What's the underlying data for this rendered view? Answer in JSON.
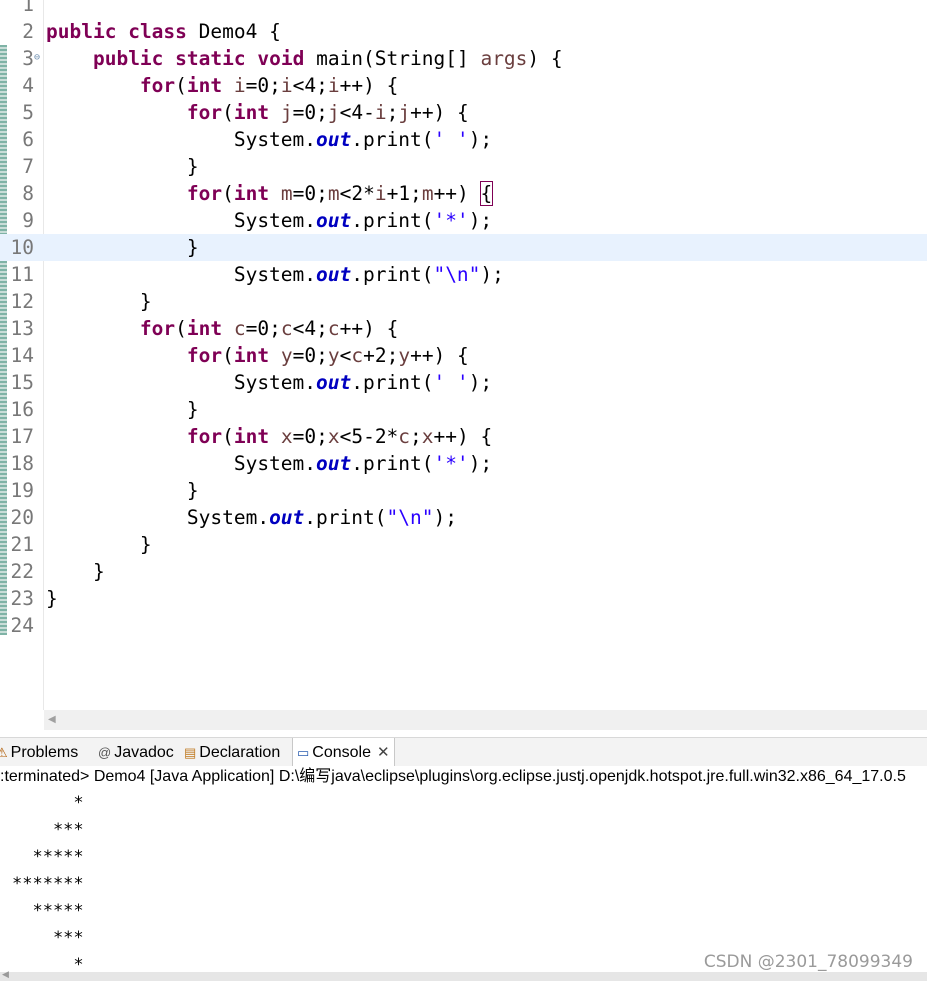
{
  "editor": {
    "lines": [
      {
        "n": "1",
        "code": ""
      },
      {
        "n": "2",
        "code": "public class Demo4 {"
      },
      {
        "n": "3",
        "code": "    public static void main(String[] args) {"
      },
      {
        "n": "4",
        "code": "        for(int i=0;i<4;i++) {"
      },
      {
        "n": "5",
        "code": "            for(int j=0;j<4-i;j++) {"
      },
      {
        "n": "6",
        "code": "                System.out.print(' ');"
      },
      {
        "n": "7",
        "code": "            }"
      },
      {
        "n": "8",
        "code": "            for(int m=0;m<2*i+1;m++) {"
      },
      {
        "n": "9",
        "code": "                System.out.print('*');"
      },
      {
        "n": "10",
        "code": "            }"
      },
      {
        "n": "11",
        "code": "                System.out.print(\"\\n\");"
      },
      {
        "n": "12",
        "code": "        }"
      },
      {
        "n": "13",
        "code": "        for(int c=0;c<4;c++) {"
      },
      {
        "n": "14",
        "code": "            for(int y=0;y<c+2;y++) {"
      },
      {
        "n": "15",
        "code": "                System.out.print(' ');"
      },
      {
        "n": "16",
        "code": "            }"
      },
      {
        "n": "17",
        "code": "            for(int x=0;x<5-2*c;x++) {"
      },
      {
        "n": "18",
        "code": "                System.out.print('*');"
      },
      {
        "n": "19",
        "code": "            }"
      },
      {
        "n": "20",
        "code": "            System.out.print(\"\\n\");"
      },
      {
        "n": "21",
        "code": "        }"
      },
      {
        "n": "22",
        "code": "    }"
      },
      {
        "n": "23",
        "code": "}"
      },
      {
        "n": "24",
        "code": ""
      }
    ],
    "current_line": "10",
    "fold_marker_line": "3",
    "icons": {
      "fold": "collapse-icon",
      "scroll_left": "scroll-left-arrow-icon"
    }
  },
  "tabs": [
    {
      "label": "Problems",
      "icon": "problems-icon",
      "glyph": "⚠"
    },
    {
      "label": "Javadoc",
      "icon": "javadoc-icon",
      "glyph": "@"
    },
    {
      "label": "Declaration",
      "icon": "declaration-icon",
      "glyph": "▤"
    },
    {
      "label": "Console",
      "icon": "console-icon",
      "glyph": "▭"
    }
  ],
  "active_tab": "Console",
  "console": {
    "description": ":terminated> Demo4 [Java Application] D:\\编写java\\eclipse\\plugins\\org.eclipse.justj.openjdk.hotspot.jre.full.win32.x86_64_17.0.5",
    "output": [
      "      *",
      "    ***",
      "  *****",
      "*******",
      "  *****",
      "    ***",
      "      *"
    ]
  },
  "watermark": "CSDN @2301_78099349",
  "colors": {
    "keyword": "#7f0055",
    "field": "#0000c0",
    "string": "#2a00ff",
    "variable": "#6a3e3e",
    "current_line_bg": "#e8f2fe",
    "line_number": "#787878"
  }
}
